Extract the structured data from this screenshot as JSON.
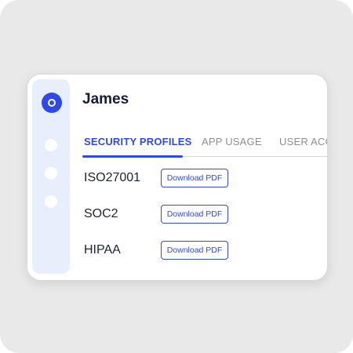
{
  "app": {
    "user_name": "James"
  },
  "sidebar": {
    "logo_icon": "target-logo-icon",
    "items": [
      {
        "icon": "nav-dot-icon"
      },
      {
        "icon": "nav-dot-icon"
      },
      {
        "icon": "nav-dot-icon"
      }
    ]
  },
  "tabs": [
    {
      "label": "SECURITY PROFILES",
      "active": true
    },
    {
      "label": "APP USAGE",
      "active": false
    },
    {
      "label": "USER ACC",
      "active": false
    }
  ],
  "profiles": [
    {
      "name": "ISO27001",
      "action_label": "Download PDF"
    },
    {
      "name": "SOC2",
      "action_label": "Download PDF"
    },
    {
      "name": "HIPAA",
      "action_label": "Download PDF"
    }
  ],
  "colors": {
    "accent": "#2f49e6",
    "sidebar_bg": "#e9eefd",
    "page_bg": "#e9e9ea",
    "title_text": "#151b3a",
    "inactive_tab": "#8a8e99"
  }
}
